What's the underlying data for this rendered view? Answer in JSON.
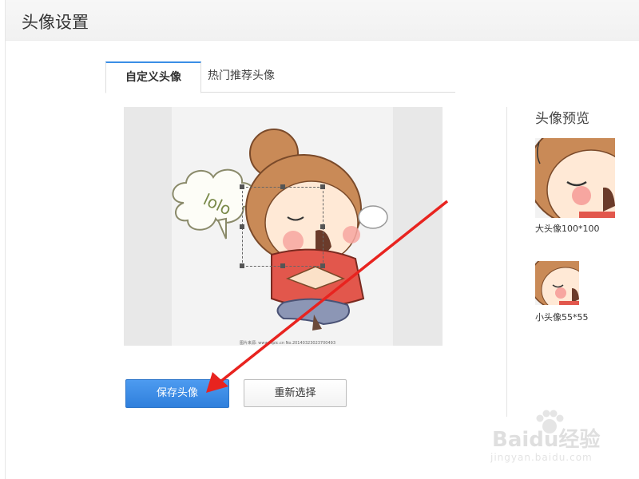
{
  "header": {
    "title": "头像设置"
  },
  "tabs": [
    {
      "label": "自定义头像",
      "active": true
    },
    {
      "label": "热门推荐头像",
      "active": false
    }
  ],
  "editor": {
    "bubble_text": "lolo",
    "image_caption": "图片来源: www.nipic.cn  No.20140323023700493"
  },
  "preview": {
    "title": "头像预览",
    "large_label": "大头像100*100",
    "small_label": "小头像55*55"
  },
  "buttons": {
    "save": "保存头像",
    "reselect": "重新选择"
  },
  "watermark": {
    "brand": "Baidu经验",
    "url": "jingyan.baidu.com"
  },
  "colors": {
    "accent": "#3a8ee6",
    "annotation_arrow": "#e8231f"
  }
}
